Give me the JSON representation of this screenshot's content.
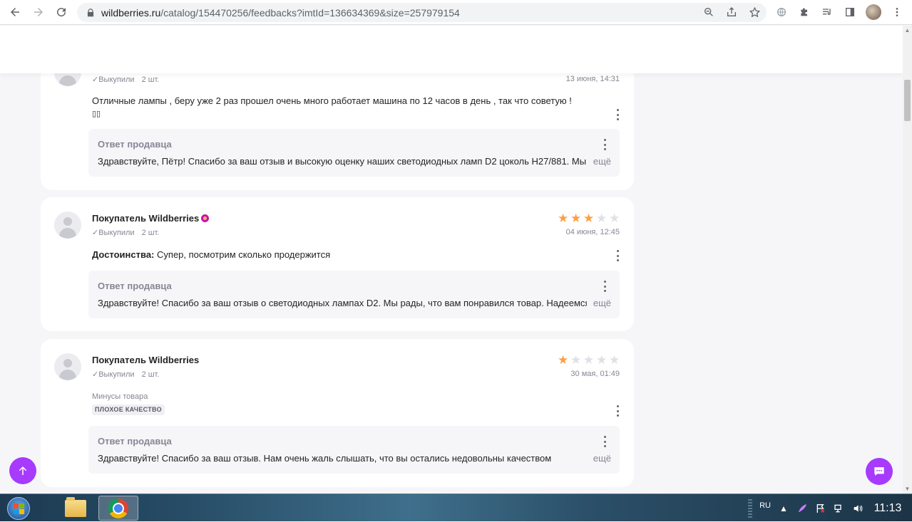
{
  "browser": {
    "url_domain": "wildberries.ru",
    "url_path": "/catalog/154470256/feedbacks?imtId=136634369&size=257979154"
  },
  "reviews": [
    {
      "bought_label": "✓Выкупили",
      "qty": "2 шт.",
      "date": "13 июня, 14:31",
      "text_line1": "Отличные лампы , беру уже 2 раз прошел очень много работает машина по 12 часов в день , так что советую !",
      "text_line2": "▯▯",
      "reply_title": "Ответ продавца",
      "reply_text": "Здравствуйте, Пётр! Спасибо за ваш отзыв и высокую оценку наших светодиодных ламп D2 цоколь H27/881. Мы",
      "more": "ещё"
    },
    {
      "name": "Покупатель Wildberries",
      "bought_label": "✓Выкупили",
      "qty": "2 шт.",
      "date": "04 июня, 12:45",
      "rating": 3,
      "pros_label": "Достоинства:",
      "pros_text": "Супер, посмотрим сколько продержится",
      "reply_title": "Ответ продавца",
      "reply_text": "Здравствуйте! Спасибо за ваш отзыв о светодиодных лампах D2. Мы рады, что вам понравился товар. Надеемся,",
      "more": "ещё"
    },
    {
      "name": "Покупатель Wildberries",
      "bought_label": "✓Выкупили",
      "qty": "2 шт.",
      "date": "30 мая, 01:49",
      "rating": 1,
      "cons_label": "Минусы товара",
      "cons_tag": "ПЛОХОЕ КАЧЕСТВО",
      "reply_title": "Ответ продавца",
      "reply_text": "Здравствуйте! Спасибо за ваш отзыв. Нам очень жаль слышать, что вы остались недовольны качеством",
      "more": "ещё"
    }
  ],
  "taskbar": {
    "lang": "RU",
    "time": "11:13"
  },
  "colors": {
    "accent": "#a73afd",
    "star_on": "#ff9e43",
    "star_off": "#e0e0e6",
    "badge": "#cb11ab"
  }
}
